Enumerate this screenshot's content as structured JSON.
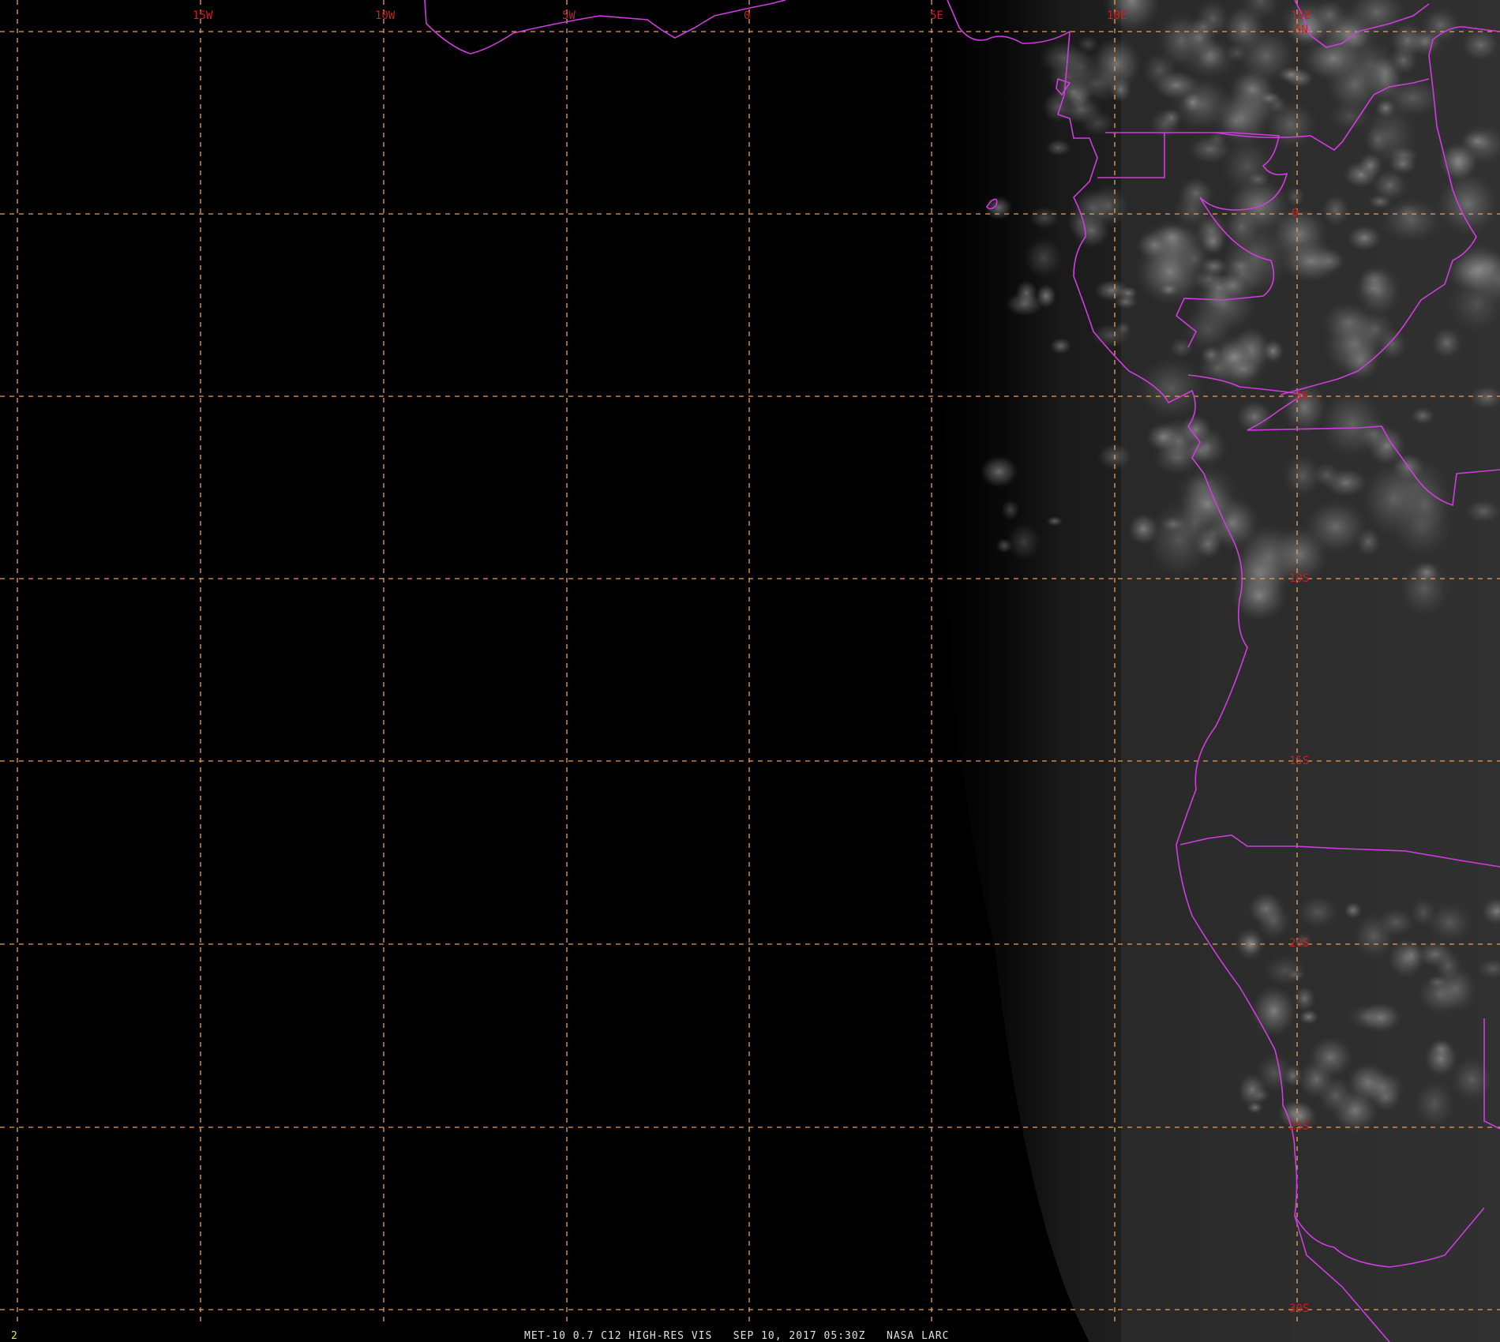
{
  "title_bar": "MET-10 0.7 C12 HIGH-RES VIS   SEP 10, 2017 05:30Z   NASA LARC",
  "frame_number": "2",
  "colors": {
    "background": "#000000",
    "grid": "#e8a05a",
    "label": "#c82020",
    "boundaries": "#d03ce0",
    "footer_text": "#e0e0e0",
    "frame_number": "#e8e040"
  },
  "map": {
    "longitude_labels": [
      "15W",
      "10W",
      "5W",
      "0",
      "5E",
      "10E",
      "15E"
    ],
    "latitude_labels": [
      "5N",
      "0",
      "5S",
      "10S",
      "15S",
      "20S",
      "25S",
      "30S"
    ]
  }
}
